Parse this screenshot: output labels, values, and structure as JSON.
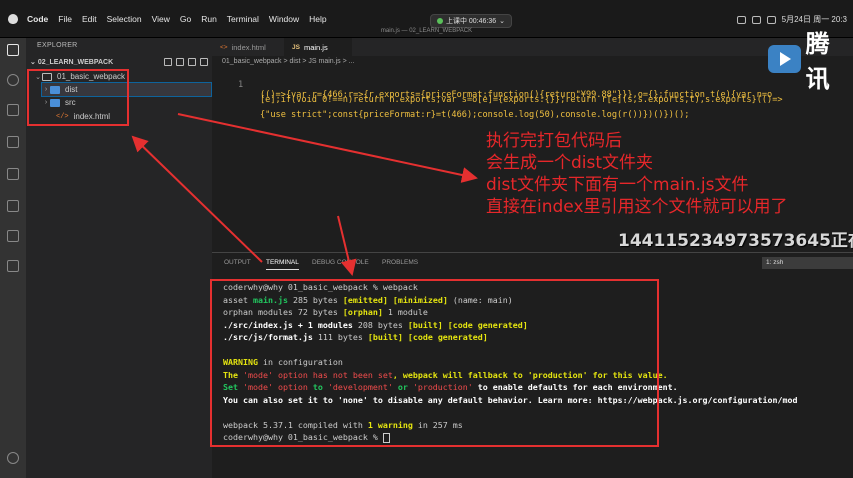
{
  "menubar": {
    "app": "Code",
    "items": [
      "File",
      "Edit",
      "Selection",
      "View",
      "Go",
      "Run",
      "Terminal",
      "Window",
      "Help"
    ],
    "recording": "上课中 00:46:36",
    "window_title": "main.js — 02_LEARN_WEBPACK",
    "datetime": "5月24日 周一 20:3"
  },
  "explorer": {
    "header": "EXPLORER",
    "project": "02_LEARN_WEBPACK",
    "tree": [
      {
        "label": "01_basic_webpack",
        "type": "folder-open"
      },
      {
        "label": "dist",
        "type": "folder"
      },
      {
        "label": "src",
        "type": "folder"
      },
      {
        "label": "index.html",
        "type": "html"
      }
    ]
  },
  "editor": {
    "tabs": [
      {
        "label": "index.html",
        "icon": "<>"
      },
      {
        "label": "main.js",
        "icon": "JS"
      }
    ],
    "breadcrumb": "01_basic_webpack > dist > JS main.js > ...",
    "line_number": "1",
    "code_lines": [
      "(()=>{var r={466:r=>{r.exports={priceFormat:function(){return\"¥99.88\"}}},o={};function t(e){var n=o",
      "[e];if(void 0!==n)return n.exports;var s=o[e]={exports:{}};return r[e](s,s.exports,t),s.exports}(()=>",
      "{\"use strict\";const{priceFormat:r}=t(466);console.log(50),console.log(r())})()})();"
    ]
  },
  "panel": {
    "tabs": [
      "OUTPUT",
      "TERMINAL",
      "DEBUG CONSOLE",
      "PROBLEMS"
    ],
    "shell": "1: zsh",
    "terminal": {
      "prompt1": "coderwhy@why 01_basic_webpack % webpack",
      "asset_pre": "asset ",
      "asset_name": "main.js",
      "asset_size": " 285 bytes ",
      "asset_emitted": "[emitted]",
      "asset_minimized": "[minimized]",
      "asset_post": " (name: main)",
      "orphan_pre": "orphan modules 72 bytes ",
      "orphan_tag": "[orphan]",
      "orphan_post": " 1 module",
      "index_name": "./src/index.js + 1 modules",
      "index_size": " 208 bytes ",
      "built": "[built]",
      "code_generated": "[code generated]",
      "format_name": "./src/js/format.js",
      "format_size": " 111 bytes ",
      "warning_label": "WARNING",
      "warning_rest": " in configuration",
      "line_the": "The ",
      "mode_not_set": "'mode' option has not been set",
      "line_fallback": ", webpack will fallback to 'production' for this value.",
      "set_pre": "Set ",
      "mode_option": "'mode' option",
      "to": " to ",
      "development": "'development'",
      "or": " or ",
      "production": "'production'",
      "set_post": " to enable defaults for each environment.",
      "also": "You can also set it to 'none' to disable any default behavior. Learn more: https://webpack.js.org/configuration/mod",
      "compiled_pre": "webpack 5.37.1 compiled with ",
      "compiled_warn": "1 warning",
      "compiled_post": " in 257 ms",
      "prompt2": "coderwhy@why 01_basic_webpack % "
    }
  },
  "annotation": {
    "lines": [
      "执行完打包代码后",
      "会生成一个dist文件夹",
      "dist文件夹下面有一个main.js文件",
      "直接在index里引用这个文件就可以用了"
    ],
    "danmaku": "144115234973573645正在",
    "logo": "腾讯"
  },
  "colors": {
    "annotation": "#e6272a",
    "accent": "#0e639c",
    "warning": "#e5e510",
    "success": "#22c55e"
  }
}
